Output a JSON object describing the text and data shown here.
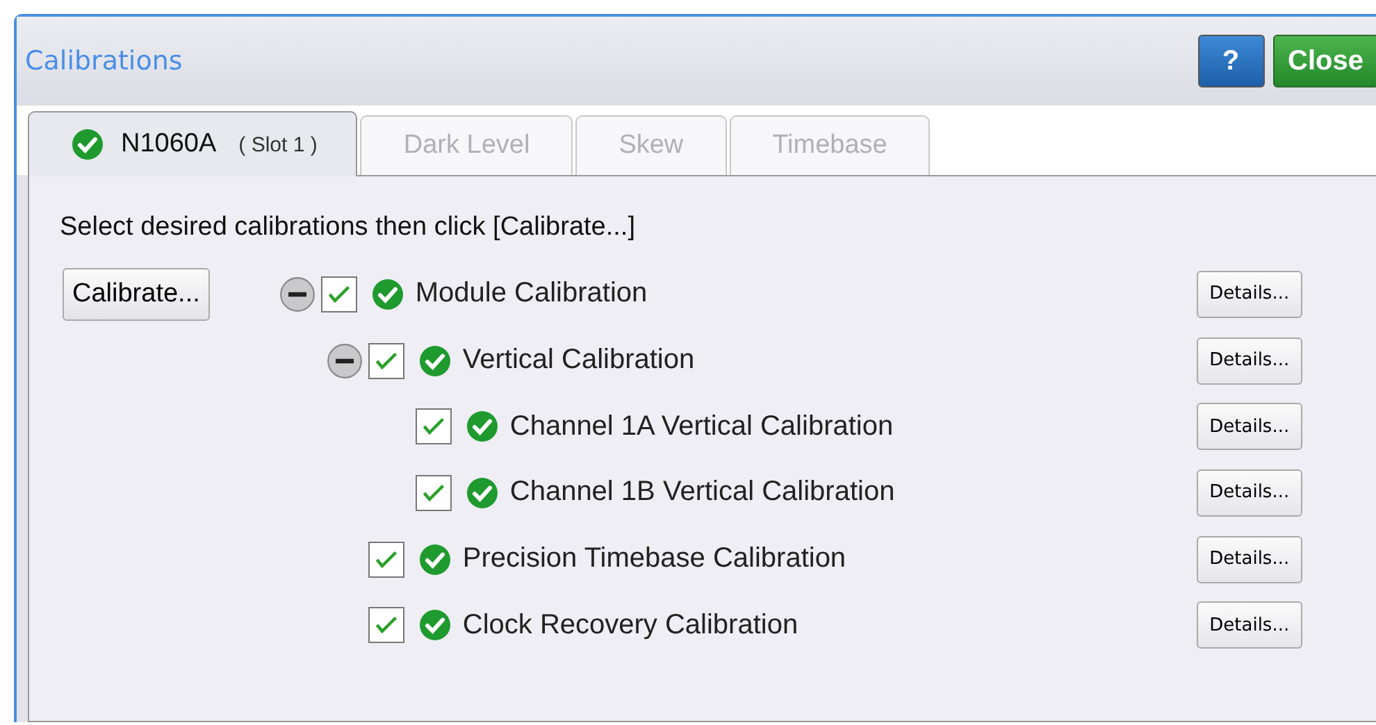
{
  "window": {
    "title": "Calibrations"
  },
  "header_buttons": [
    {
      "kind": "help",
      "label": "?"
    },
    {
      "kind": "close",
      "label": "Close"
    }
  ],
  "tabs": [
    {
      "label": "N1060A",
      "sublabel": "( Slot 1 )",
      "passed": true,
      "selected": true
    },
    {
      "label": "Dark Level",
      "selected": false
    },
    {
      "label": "Skew",
      "selected": false
    },
    {
      "label": "Timebase",
      "selected": false
    }
  ],
  "instruction": "Select desired calibrations then click [Calibrate...]",
  "calibrate_button": "Calibrate...",
  "calibrations": [
    {
      "label": "Module Calibration",
      "checked": true,
      "passed": true,
      "expanded": true,
      "details": "Details...",
      "children": [
        {
          "label": "Vertical Calibration",
          "checked": true,
          "passed": true,
          "expanded": true,
          "details": "Details...",
          "children": [
            {
              "label": "Channel 1A Vertical Calibration",
              "checked": true,
              "passed": true,
              "details": "Details..."
            },
            {
              "label": "Channel 1B Vertical Calibration",
              "checked": true,
              "passed": true,
              "details": "Details..."
            }
          ]
        },
        {
          "label": "Precision Timebase Calibration",
          "checked": true,
          "passed": true,
          "details": "Details..."
        },
        {
          "label": "Clock Recovery Calibration",
          "checked": true,
          "passed": true,
          "details": "Details..."
        }
      ]
    }
  ]
}
